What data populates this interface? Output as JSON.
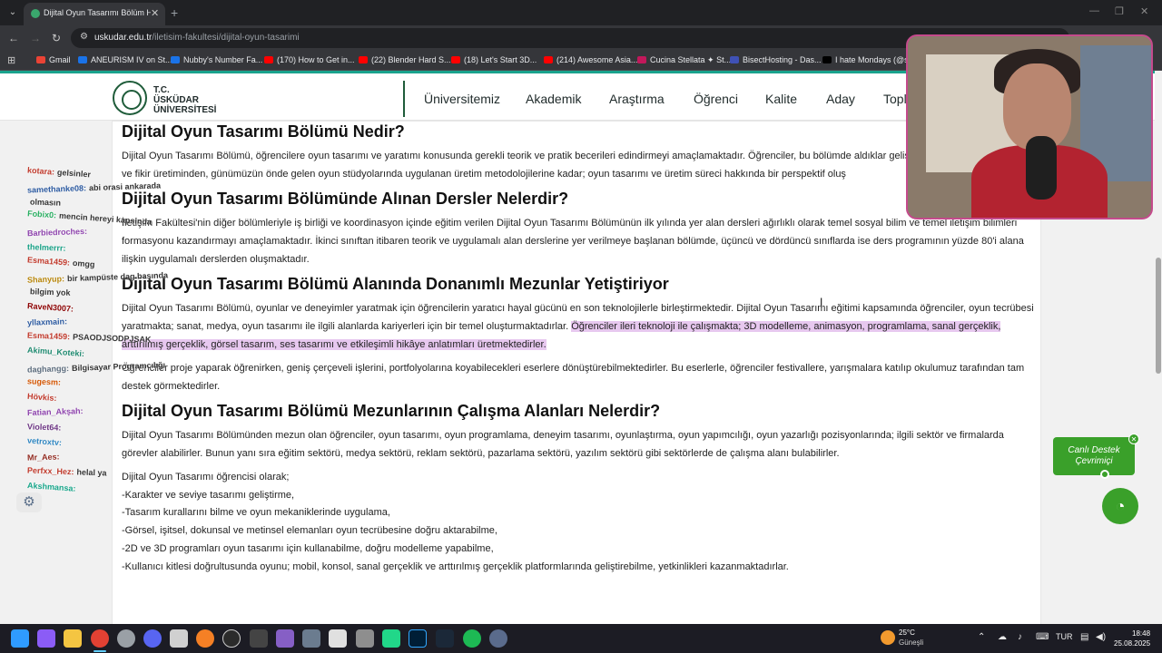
{
  "browser": {
    "tab": {
      "title": "Dijital Oyun Tasarımı Bölüm Hakkında"
    },
    "address": {
      "domain": "uskudar.edu.tr",
      "path": "/iletisim-fakultesi/dijital-oyun-tasarimi"
    },
    "bookmarks": [
      {
        "label": "Gmail",
        "color": "#ea4335"
      },
      {
        "label": "ANEURISM IV on St...",
        "color": "#1a73e8"
      },
      {
        "label": "Nubby's Number Fa...",
        "color": "#1a73e8"
      },
      {
        "label": "(170) How to Get in...",
        "color": "#ff0000"
      },
      {
        "label": "(22) Blender Hard S...",
        "color": "#ff0000"
      },
      {
        "label": "(18) Let's Start 3D...",
        "color": "#ff0000"
      },
      {
        "label": "(214) Awesome Asia...",
        "color": "#ff0000"
      },
      {
        "label": "Cucina Stellata ✦ St...",
        "color": "#c2185b"
      },
      {
        "label": "BisectHosting - Das...",
        "color": "#3f51b5"
      },
      {
        "label": "I hate Mondays (@s...",
        "color": "#000000"
      }
    ]
  },
  "site": {
    "logo": {
      "line1": "T.C.",
      "line2": "ÜSKÜDAR",
      "line3": "ÜNİVERSİTESİ"
    },
    "menu": [
      "Üniversitemiz",
      "Akademik",
      "Araştırma",
      "Öğrenci",
      "Kalite",
      "Aday",
      "Topl"
    ]
  },
  "article": {
    "s1": {
      "title": "Dijital Oyun Tasarımı Bölümü Nedir?",
      "p": "Dijital Oyun Tasarımı Bölümü, öğrencilere oyun tasarımı ve yaratımı konusunda gerekli teorik ve pratik becerileri edindirmeyi amaçlamaktadır. Öğrenciler, bu bölümde aldıklar geliştirme ve fikir üretiminden, günümüzün önde gelen oyun stüdyolarında uygulanan üretim metodolojilerine kadar; oyun tasarımı ve üretim süreci hakkında bir perspektif oluş"
    },
    "s2": {
      "title": "Dijital Oyun Tasarımı Bölümünde Alınan Dersler Nelerdir?",
      "p": "İletişim Fakültesi'nin diğer bölümleriyle iş birliği ve koordinasyon içinde eğitim verilen Dijital Oyun Tasarımı Bölümünün ilk yılında yer alan dersleri ağırlıklı olarak temel sosyal bilim ve temel iletişim bilimleri formasyonu kazandırmayı amaçlamaktadır. İkinci sınıftan itibaren teorik ve uygulamalı alan derslerine yer verilmeye başlanan bölümde, üçüncü ve dördüncü sınıflarda ise ders programının yüzde 80'i alana ilişkin uygulamalı derslerden oluşmaktadır."
    },
    "s3": {
      "title": "Dijital Oyun Tasarımı Bölümü Alanında Donanımlı Mezunlar Yetiştiriyor",
      "p_start": "Dijital Oyun Tasarımı Bölümü, oyunlar ve deneyimler yaratmak için öğrencilerin yaratıcı hayal gücünü en son teknolojilerle birleştirmektedir. Dijital Oyun Tasarımı eğitimi kapsamında öğrenciler, oyun tecrübesi yaratmakta; sanat, medya, oyun tasarımı ile ilgili alanlarda kariyerleri için bir temel oluşturmaktadırlar. ",
      "p_highlight": "Öğrenciler ileri teknoloji ile çalışmakta; 3D modelleme, animasyon, programlama, sanal gerçeklik, arttırılmış gerçeklik, görsel tasarım, ses tasarımı ve etkileşimli hikâye anlatımları üretmektedirler.",
      "p2": "Öğrenciler proje yaparak öğrenirken, geniş çerçeveli işlerini, portfolyolarına koyabilecekleri eserlere dönüştürebilmektedirler. Bu eserlerle, öğrenciler festivallere, yarışmalara katılıp okulumuz tarafından tam destek görmektedirler."
    },
    "s4": {
      "title": "Dijital Oyun Tasarımı Bölümü Mezunlarının Çalışma Alanları Nelerdir?",
      "p": "Dijital Oyun Tasarımı Bölümünden mezun olan öğrenciler, oyun tasarımı, oyun programlama, deneyim tasarımı, oyunlaştırma, oyun yapımcılığı, oyun yazarlığı pozisyonlarında; ilgili sektör ve firmalarda görevler alabilirler. Bunun yanı sıra eğitim sektörü, medya sektörü, reklam sektörü, pazarlama sektörü, yazılım sektörü gibi sektörlerde de çalışma alanı bulabilirler.",
      "list_intro": "Dijital Oyun Tasarımı öğrencisi olarak;",
      "list": [
        "-Karakter ve seviye tasarımı geliştirme,",
        "-Tasarım kurallarını bilme ve oyun mekaniklerinde uygulama,",
        "-Görsel, işitsel, dokunsal ve metinsel elemanları oyun tecrübesine doğru aktarabilme,",
        "-2D ve 3D programları oyun tasarımı için kullanabilme, doğru modelleme yapabilme,",
        "-Kullanıcı kitlesi doğrultusunda oyunu; mobil, konsol, sanal gerçeklik ve arttırılmış gerçeklik platformlarında geliştirebilme, yetkinlikleri kazanmaktadırlar."
      ]
    }
  },
  "chat_overlay": [
    {
      "name": "kotara:",
      "text": "gelsinler",
      "color": "#c0392b"
    },
    {
      "name": "samethanke08:",
      "text": "abi orasi ankarada",
      "color": "#2c5aa0"
    },
    {
      "name": "",
      "text": "olmasın",
      "color": "#2c5aa0"
    },
    {
      "name": "Fobix0:",
      "text": "mencin hereyi kapsinda",
      "color": "#27ae60"
    },
    {
      "name": "Barbiedroches:",
      "text": "",
      "color": "#8e44ad"
    },
    {
      "name": "thelmerrr:",
      "text": "",
      "color": "#16a085"
    },
    {
      "name": "Esma1459:",
      "text": "omgg",
      "color": "#c0392b"
    },
    {
      "name": "Shanyup:",
      "text": "bir kampüste dag başında",
      "color": "#b8860b"
    },
    {
      "name": "",
      "text": "bilgim yok",
      "color": "#b8860b"
    },
    {
      "name": "RaveN3007:",
      "text": "",
      "color": "#8b0000"
    },
    {
      "name": "yllaxmain:",
      "text": "",
      "color": "#2c5aa0"
    },
    {
      "name": "Esma1459:",
      "text": "PSAODJSODPJSAK",
      "color": "#c0392b"
    },
    {
      "name": "Akimu_Koteki:",
      "text": "",
      "color": "#1f8a70"
    },
    {
      "name": "daghangg:",
      "text": "Bilgisayar Programcılığı",
      "color": "#5d6d7e"
    },
    {
      "name": "sugesm:",
      "text": "",
      "color": "#d35400"
    },
    {
      "name": "Hövkis:",
      "text": "",
      "color": "#c0392b"
    },
    {
      "name": "Fatian_Akşah:",
      "text": "",
      "color": "#8e44ad"
    },
    {
      "name": "Violet64:",
      "text": "",
      "color": "#6c3483"
    },
    {
      "name": "vetroxtv:",
      "text": "",
      "color": "#2e86c1"
    },
    {
      "name": "Mr_Aes:",
      "text": "",
      "color": "#922b21"
    },
    {
      "name": "Perfxx_Hez:",
      "text": "helal ya",
      "color": "#c0392b"
    },
    {
      "name": "Akshmansa:",
      "text": "",
      "color": "#17a589"
    }
  ],
  "live_support": {
    "line1": "Canlı Destek",
    "line2": "Çevrimiçi"
  },
  "taskbar": {
    "weather": {
      "temp": "25°C",
      "desc": "Güneşli"
    },
    "lang": "TUR",
    "time": "18:48",
    "date": "25.08.2025"
  }
}
